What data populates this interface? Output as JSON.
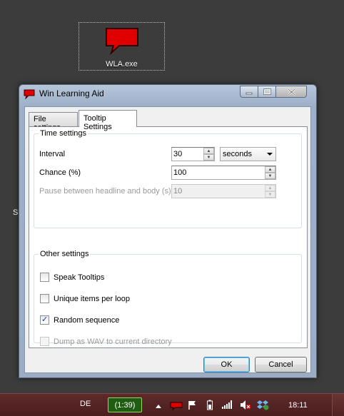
{
  "desktop": {
    "icon_label": "WLA.exe",
    "stray_text": "S"
  },
  "window": {
    "title": "Win Learning Aid",
    "tabs": [
      {
        "label": "File settings",
        "active": false
      },
      {
        "label": "Tooltip Settings",
        "active": true
      }
    ],
    "time_settings": {
      "title": "Time settings",
      "interval_label": "Interval",
      "interval_value": "30",
      "interval_unit": "seconds",
      "chance_label": "Chance (%)",
      "chance_value": "100",
      "pause_label": "Pause between headline and body (s)",
      "pause_value": "10"
    },
    "other_settings": {
      "title": "Other settings",
      "options": [
        {
          "label": "Speak Tooltips",
          "checked": false,
          "enabled": true
        },
        {
          "label": "Unique items per loop",
          "checked": false,
          "enabled": true
        },
        {
          "label": "Random sequence",
          "checked": true,
          "enabled": true
        },
        {
          "label": "Dump as WAV to current directory",
          "checked": false,
          "enabled": false
        }
      ]
    },
    "ok_label": "OK",
    "cancel_label": "Cancel"
  },
  "taskbar": {
    "language": "DE",
    "battery_text": "(1:39)",
    "clock": "18:11",
    "tray_icons": [
      "show-hidden-icons",
      "wla-tray-icon",
      "action-center-flag-icon",
      "battery-icon",
      "signal-bars-icon",
      "volume-muted-icon",
      "dropbox-icon"
    ]
  },
  "colors": {
    "accent_red": "#e00000",
    "taskbar": "#4a1e1e",
    "battery_widget": "#1e5d12"
  }
}
